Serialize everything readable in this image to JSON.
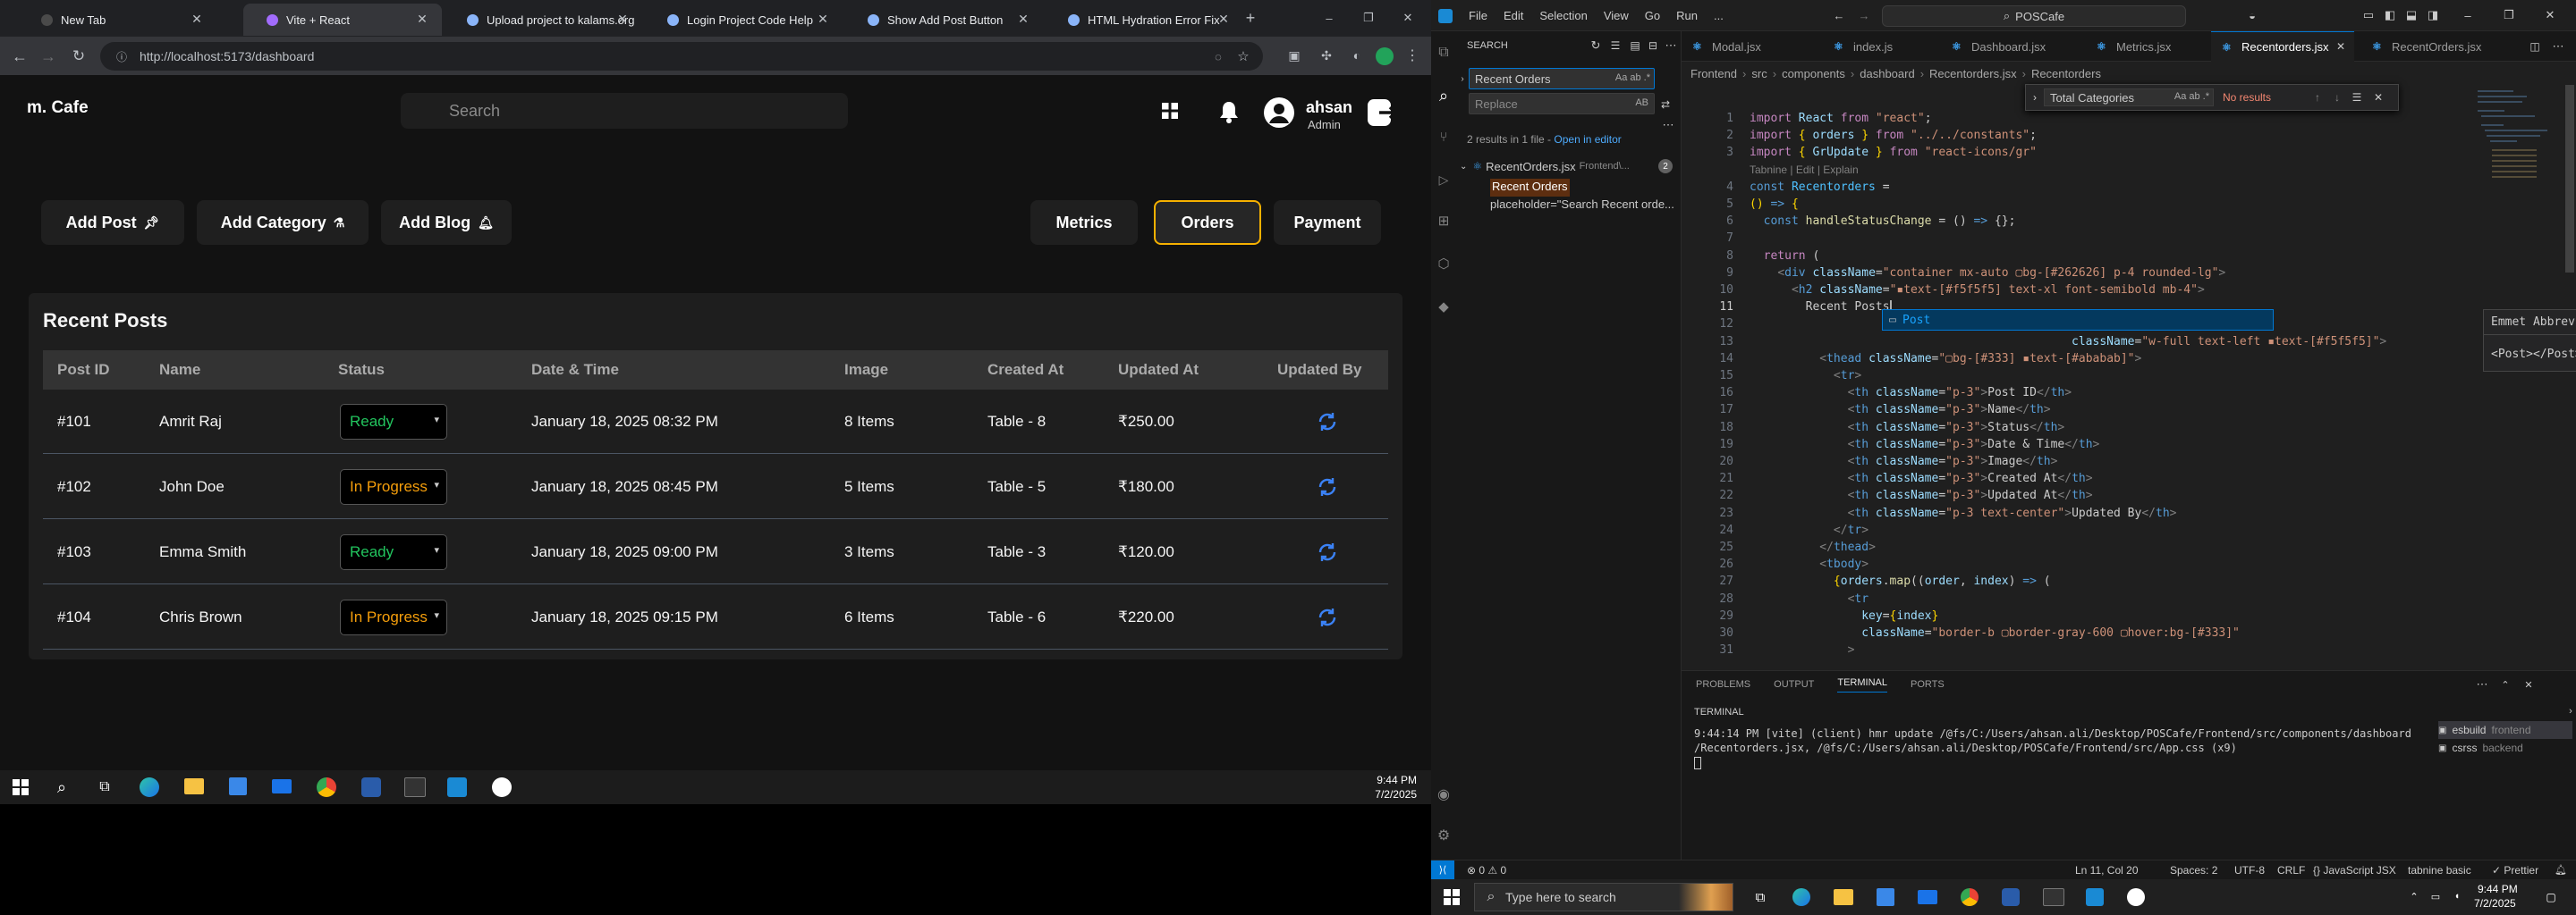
{
  "browser": {
    "tabs": [
      {
        "title": "New Tab",
        "fav": "#4a4a4a"
      },
      {
        "title": "Vite + React",
        "fav": "#a26cfd"
      },
      {
        "title": "Upload project to kalams.org",
        "fav": "#8ab4f8"
      },
      {
        "title": "Login Project Code Help",
        "fav": "#8ab4f8"
      },
      {
        "title": "Show Add Post Button",
        "fav": "#8ab4f8"
      },
      {
        "title": "HTML Hydration Error Fix",
        "fav": "#8ab4f8"
      }
    ],
    "url": "http://localhost:5173/dashboard"
  },
  "app": {
    "logo": "m. Cafe",
    "search_placeholder": "Search",
    "user_name": "ahsan",
    "user_role": "Admin",
    "actions": [
      {
        "label": "Add Post",
        "icon": "pin-icon"
      },
      {
        "label": "Add Category",
        "icon": "flask-icon"
      },
      {
        "label": "Add Blog",
        "icon": "bell-icon"
      }
    ],
    "tabs": [
      {
        "label": "Metrics",
        "active": false
      },
      {
        "label": "Orders",
        "active": true
      },
      {
        "label": "Payment",
        "active": false
      }
    ],
    "panel_title": "Recent Posts",
    "columns": [
      "Post ID",
      "Name",
      "Status",
      "Date & Time",
      "Image",
      "Created At",
      "Updated At",
      "Updated By"
    ],
    "rows": [
      {
        "id": "#101",
        "name": "Amrit Raj",
        "status": "Ready",
        "date": "January 18, 2025 08:32 PM",
        "image": "8 Items",
        "created": "Table - 8",
        "updated": "₹250.00"
      },
      {
        "id": "#102",
        "name": "John Doe",
        "status": "In Progress",
        "date": "January 18, 2025 08:45 PM",
        "image": "5 Items",
        "created": "Table - 5",
        "updated": "₹180.00"
      },
      {
        "id": "#103",
        "name": "Emma Smith",
        "status": "Ready",
        "date": "January 18, 2025 09:00 PM",
        "image": "3 Items",
        "created": "Table - 3",
        "updated": "₹120.00"
      },
      {
        "id": "#104",
        "name": "Chris Brown",
        "status": "In Progress",
        "date": "January 18, 2025 09:15 PM",
        "image": "6 Items",
        "created": "Table - 6",
        "updated": "₹220.00"
      }
    ],
    "colors": {
      "ready": "#22c55e",
      "in_progress": "#f59e0b",
      "refresh": "#3b82f6"
    }
  },
  "taskbar1": {
    "time": "9:44 PM",
    "date": "7/2/2025"
  },
  "vscode": {
    "menu": [
      "File",
      "Edit",
      "Selection",
      "View",
      "Go",
      "Run",
      "..."
    ],
    "command_center": "POSCafe",
    "sidebar": {
      "header": "SEARCH",
      "search_value": "Recent Orders",
      "replace_placeholder": "Replace",
      "results_summary": "2 results in 1 file",
      "open_in_editor": "Open in editor",
      "file": "RecentOrders.jsx",
      "file_path": "Frontend\\...",
      "file_count": "2",
      "matches": [
        "Recent Orders",
        "placeholder=\"Search Recent orde..."
      ]
    },
    "tabs": [
      "Modal.jsx",
      "index.js",
      "Dashboard.jsx",
      "Metrics.jsx",
      "Recentorders.jsx",
      "RecentOrders.jsx"
    ],
    "active_tab": 4,
    "breadcrumb": [
      "Frontend",
      "src",
      "components",
      "dashboard",
      "Recentorders.jsx",
      "Recentorders"
    ],
    "find_widget": {
      "value": "Total Categories",
      "result": "No results"
    },
    "lines": [
      {
        "n": "1",
        "html": "<span class='kw'>import</span> <span class='var'>React</span> <span class='kw'>from</span> <span class='str'>\"react\"</span>;"
      },
      {
        "n": "2",
        "html": "<span class='kw'>import</span> <span class='br'>{</span> <span class='var'>orders</span> <span class='br'>}</span> <span class='kw'>from</span> <span class='str'>\"../../constants\"</span>;"
      },
      {
        "n": "3",
        "html": "<span class='kw'>import</span> <span class='br'>{</span> <span class='var'>GrUpdate</span> <span class='br'>}</span> <span class='kw'>from</span> <span class='str'>\"react-icons/gr\"</span>"
      },
      {
        "n": "",
        "html": "<span class='gr' style='font-family:Liberation Sans,sans-serif;font-size:12px'>Tabnine | Edit | Explain</span>"
      },
      {
        "n": "4",
        "html": "<span class='kb'>const</span> <span class='cl'>Recentorders</span> ="
      },
      {
        "n": "5",
        "html": "<span class='br'>()</span> <span class='kb'>=&gt;</span> <span class='br'>{</span>"
      },
      {
        "n": "6",
        "html": "  <span class='kb'>const</span> <span class='fn'>handleStatusChange</span> = () <span class='kb'>=&gt;</span> {};"
      },
      {
        "n": "7",
        "html": ""
      },
      {
        "n": "8",
        "html": "  <span class='kw'>return</span> ("
      },
      {
        "n": "9",
        "html": "    <span class='gr'>&lt;</span><span class='tag'>div</span> <span class='attr'>className</span>=<span class='str'>\"container mx-auto ▢bg-[#262626] p-4 rounded-lg\"</span><span class='gr'>&gt;</span>"
      },
      {
        "n": "10",
        "html": "      <span class='gr'>&lt;</span><span class='tag'>h2</span> <span class='attr'>className</span>=<span class='str'>\"▪text-[#f5f5f5] text-xl font-semibold mb-4\"</span><span class='gr'>&gt;</span>"
      },
      {
        "n": "11",
        "html": "        Recent Posts"
      },
      {
        "n": "12",
        "html": "                                              <span class='str'>e=\"overflow-x-auto\"</span><span class='gr'>&gt;</span>"
      },
      {
        "n": "13",
        "html": "                                              <span class='attr'>className</span>=<span class='str'>\"w-full text-left ▪text-[#f5f5f5]\"</span><span class='gr'>&gt;</span>"
      },
      {
        "n": "14",
        "html": "          <span class='gr'>&lt;</span><span class='tag'>thead</span> <span class='attr'>className</span>=<span class='str'>\"▢bg-[#333] ▪text-[#ababab]\"</span><span class='gr'>&gt;</span>"
      },
      {
        "n": "15",
        "html": "            <span class='gr'>&lt;</span><span class='tag'>tr</span><span class='gr'>&gt;</span>"
      },
      {
        "n": "16",
        "html": "              <span class='gr'>&lt;</span><span class='tag'>th</span> <span class='attr'>className</span>=<span class='str'>\"p-3\"</span><span class='gr'>&gt;</span>Post ID<span class='gr'>&lt;/</span><span class='tag'>th</span><span class='gr'>&gt;</span>"
      },
      {
        "n": "17",
        "html": "              <span class='gr'>&lt;</span><span class='tag'>th</span> <span class='attr'>className</span>=<span class='str'>\"p-3\"</span><span class='gr'>&gt;</span>Name<span class='gr'>&lt;/</span><span class='tag'>th</span><span class='gr'>&gt;</span>"
      },
      {
        "n": "18",
        "html": "              <span class='gr'>&lt;</span><span class='tag'>th</span> <span class='attr'>className</span>=<span class='str'>\"p-3\"</span><span class='gr'>&gt;</span>Status<span class='gr'>&lt;/</span><span class='tag'>th</span><span class='gr'>&gt;</span>"
      },
      {
        "n": "19",
        "html": "              <span class='gr'>&lt;</span><span class='tag'>th</span> <span class='attr'>className</span>=<span class='str'>\"p-3\"</span><span class='gr'>&gt;</span>Date &amp; Time<span class='gr'>&lt;/</span><span class='tag'>th</span><span class='gr'>&gt;</span>"
      },
      {
        "n": "20",
        "html": "              <span class='gr'>&lt;</span><span class='tag'>th</span> <span class='attr'>className</span>=<span class='str'>\"p-3\"</span><span class='gr'>&gt;</span>Image<span class='gr'>&lt;/</span><span class='tag'>th</span><span class='gr'>&gt;</span>"
      },
      {
        "n": "21",
        "html": "              <span class='gr'>&lt;</span><span class='tag'>th</span> <span class='attr'>className</span>=<span class='str'>\"p-3\"</span><span class='gr'>&gt;</span>Created At<span class='gr'>&lt;/</span><span class='tag'>th</span><span class='gr'>&gt;</span>"
      },
      {
        "n": "22",
        "html": "              <span class='gr'>&lt;</span><span class='tag'>th</span> <span class='attr'>className</span>=<span class='str'>\"p-3\"</span><span class='gr'>&gt;</span>Updated At<span class='gr'>&lt;/</span><span class='tag'>th</span><span class='gr'>&gt;</span>"
      },
      {
        "n": "23",
        "html": "              <span class='gr'>&lt;</span><span class='tag'>th</span> <span class='attr'>className</span>=<span class='str'>\"p-3 text-center\"</span><span class='gr'>&gt;</span>Updated By<span class='gr'>&lt;/</span><span class='tag'>th</span><span class='gr'>&gt;</span>"
      },
      {
        "n": "24",
        "html": "            <span class='gr'>&lt;/</span><span class='tag'>tr</span><span class='gr'>&gt;</span>"
      },
      {
        "n": "25",
        "html": "          <span class='gr'>&lt;/</span><span class='tag'>thead</span><span class='gr'>&gt;</span>"
      },
      {
        "n": "26",
        "html": "          <span class='gr'>&lt;</span><span class='tag'>tbody</span><span class='gr'>&gt;</span>"
      },
      {
        "n": "27",
        "html": "            <span class='br'>{</span><span class='var'>orders</span>.<span class='fn'>map</span>((<span class='var'>order</span>, <span class='var'>index</span>) <span class='kb'>=&gt;</span> ("
      },
      {
        "n": "28",
        "html": "              <span class='gr'>&lt;</span><span class='tag'>tr</span>"
      },
      {
        "n": "29",
        "html": "                <span class='attr'>key</span>=<span class='br'>{</span><span class='var'>index</span><span class='br'>}</span>"
      },
      {
        "n": "30",
        "html": "                <span class='attr'>className</span>=<span class='str'>\"border-b ▢border-gray-600 ▢hover:bg-[#333]\"</span>"
      },
      {
        "n": "31",
        "html": "              <span class='gr'>&gt;</span>"
      }
    ],
    "emmet": {
      "title": "Emmet Abbreviation",
      "body": "<Post></Post>",
      "suggestion": "Post"
    },
    "panel_tabs": [
      "PROBLEMS",
      "OUTPUT",
      "TERMINAL",
      "PORTS"
    ],
    "terminal_label": "TERMINAL",
    "terminal_line1": "9:44:14 PM [vite] (client) hmr update /@fs/C:/Users/ahsan.ali/Desktop/POSCafe/Frontend/src/components/dashboard",
    "terminal_line2": "/Recentorders.jsx, /@fs/C:/Users/ahsan.ali/Desktop/POSCafe/Frontend/src/App.css (x9)",
    "terminals": [
      {
        "name": "esbuild",
        "cwd": "frontend"
      },
      {
        "name": "csrss",
        "cwd": "backend"
      }
    ],
    "status": {
      "problems": "⊗ 0 ⚠ 0",
      "position": "Ln 11, Col 20",
      "spaces": "Spaces: 2",
      "encoding": "UTF-8",
      "eol": "CRLF",
      "lang": "{} JavaScript JSX",
      "tabnine": "tabnine basic",
      "prettier": "✓ Prettier"
    }
  },
  "taskbar2": {
    "search_placeholder": "Type here to search",
    "time": "9:44 PM",
    "date": "7/2/2025"
  }
}
